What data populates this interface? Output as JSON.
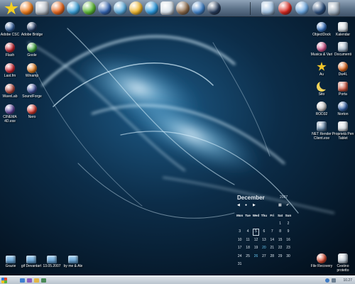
{
  "desktop": {
    "left_icons": [
      {
        "label": "Adobe CSC",
        "color": "#2c5d9e",
        "icon": "adobe-icon"
      },
      {
        "label": "Adobe Bridge",
        "color": "#1f3a66",
        "icon": "adobe-bridge-icon"
      },
      {
        "label": "Flash",
        "color": "#c81f2b",
        "icon": "flash-icon"
      },
      {
        "label": "Goole",
        "color": "#3aa539",
        "icon": "globe-icon"
      },
      {
        "label": "Last.fm",
        "color": "#d6232f",
        "icon": "lastfm-icon"
      },
      {
        "label": "Winamp",
        "color": "#e07a1a",
        "icon": "winamp-icon"
      },
      {
        "label": "WaveLab",
        "color": "#b6443a",
        "icon": "wavelab-icon"
      },
      {
        "label": "SoundForge",
        "color": "#3c4e9d",
        "icon": "soundforge-icon"
      },
      {
        "label": "CINEMA 4D.exe",
        "color": "#5b3e9a",
        "icon": "cinema4d-icon"
      },
      {
        "label": "Nero",
        "color": "#d8352a",
        "icon": "nero-icon"
      }
    ],
    "right_icons": [
      {
        "label": "ObjectDock",
        "color": "#2f6fc2",
        "icon": "objectdock-icon"
      },
      {
        "label": "Kalendar",
        "color": "#cfd7de",
        "icon": "calendar-icon"
      },
      {
        "label": "Musica & Vari",
        "color": "#d1518a",
        "icon": "music-icon"
      },
      {
        "label": "Documenti",
        "color": "#9fb4c8",
        "icon": "documents-icon"
      },
      {
        "label": "Au",
        "color": "#f2c62a",
        "icon": "star-icon"
      },
      {
        "label": "Dw4L",
        "color": "#e0641a",
        "icon": "dw-icon"
      },
      {
        "label": "Sito",
        "color": "#f1d35a",
        "icon": "moon-icon"
      },
      {
        "label": "Porta",
        "color": "#c9523e",
        "icon": "door-icon"
      },
      {
        "label": "ROD32",
        "color": "#c8c8c8",
        "icon": "skull-icon"
      },
      {
        "label": "Norton",
        "color": "#2d5da8",
        "icon": "norton-icon"
      },
      {
        "label": "NET Render Client.exe",
        "color": "#5c7e9f",
        "icon": "net-render-icon"
      },
      {
        "label": "Proprietà Pen Tablet",
        "color": "#cfd6dd",
        "icon": "pen-tablet-icon"
      },
      {
        "label": "File Recovery",
        "color": "#d8452a",
        "icon": "file-recovery-icon"
      },
      {
        "label": "Cestino protetto",
        "color": "#b7c3cf",
        "icon": "recycle-bin-icon"
      }
    ],
    "bottom_icons": [
      {
        "label": "Grazie",
        "icon": "folder-icon"
      },
      {
        "label": "gif Devantart",
        "icon": "folder-icon"
      },
      {
        "label": "13.05.2007",
        "icon": "folder-icon"
      },
      {
        "label": "by me & Ale",
        "icon": "folder-icon"
      }
    ]
  },
  "dock": {
    "icons": [
      {
        "name": "star-icon",
        "color": "#f4cf22"
      },
      {
        "name": "sun-icon",
        "color": "#ee7a17"
      },
      {
        "name": "camera-icon",
        "color": "#b7bec6"
      },
      {
        "name": "firefox-icon",
        "color": "#e8661b"
      },
      {
        "name": "messenger-icon",
        "color": "#3aa0d9"
      },
      {
        "name": "icq-flower-icon",
        "color": "#59b832"
      },
      {
        "name": "phone-icon",
        "color": "#3163b0"
      },
      {
        "name": "itunes-icon",
        "color": "#57a9dc"
      },
      {
        "name": "chat-bubble-icon",
        "color": "#f1b82d"
      },
      {
        "name": "skype-icon",
        "color": "#2b9ae0"
      },
      {
        "name": "chat-window-icon",
        "color": "#d8e2ea"
      },
      {
        "name": "rabbit-icon",
        "color": "#8b6a4a"
      },
      {
        "name": "globe-icon",
        "color": "#3f80c7"
      },
      {
        "name": "record-icon",
        "color": "#243a5a"
      },
      {
        "name": "monitor-icon",
        "color": "#9fc0e0"
      },
      {
        "name": "download-icon",
        "color": "#d8261e"
      },
      {
        "name": "safari-compass-icon",
        "color": "#6aa6e0"
      },
      {
        "name": "moon-shell-icon",
        "color": "#274a78"
      },
      {
        "name": "trash-icon",
        "color": "#9aa9b8"
      }
    ]
  },
  "calendar": {
    "month": "December",
    "year": "2007",
    "weekdays": [
      "Mon",
      "Tue",
      "Wed",
      "Thu",
      "Fri",
      "Sat",
      "Sun"
    ],
    "weeks": [
      [
        "",
        "",
        "",
        "",
        "",
        "1",
        "2"
      ],
      [
        "3",
        "4",
        "5",
        "6",
        "7",
        "8",
        "9"
      ],
      [
        "10",
        "11",
        "12",
        "13",
        "14",
        "15",
        "16"
      ],
      [
        "17",
        "18",
        "19",
        "20",
        "21",
        "22",
        "23"
      ],
      [
        "24",
        "25",
        "26",
        "27",
        "28",
        "29",
        "30"
      ],
      [
        "31",
        "",
        "",
        "",
        "",
        "",
        ""
      ]
    ],
    "today": "5",
    "highlight_days": [
      "20",
      "26"
    ]
  },
  "taskbar": {
    "clock": "10.27",
    "quick_launch": [
      {
        "name": "ie-icon",
        "color": "#3f7fd0"
      },
      {
        "name": "media-icon",
        "color": "#8a5cc2"
      },
      {
        "name": "folder-icon",
        "color": "#e2b645"
      },
      {
        "name": "desktop-icon",
        "color": "#4a8a57"
      }
    ]
  }
}
